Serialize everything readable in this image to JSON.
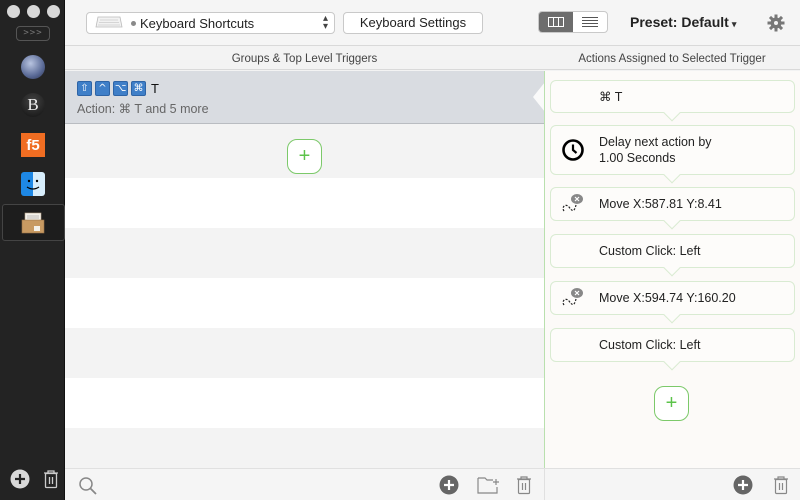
{
  "sidebar": {
    "expand_label": ">>>",
    "apps": [
      {
        "name": "globe-app",
        "icon": "globe-icon"
      },
      {
        "name": "b-app",
        "label": "B",
        "icon": "b-icon"
      },
      {
        "name": "f5-app",
        "label": "f5",
        "icon": "f5-icon"
      },
      {
        "name": "finder-app",
        "icon": "finder-icon"
      },
      {
        "name": "archive-app",
        "icon": "archive-box-icon",
        "selected": true
      }
    ],
    "bottom": {
      "add": "add-circle-icon",
      "delete": "trash-icon"
    }
  },
  "toolbar": {
    "trigger_type": "Keyboard Shortcuts",
    "keyboard_settings_label": "Keyboard Settings",
    "view_modes": [
      "columns",
      "list"
    ],
    "active_view_mode": "columns",
    "preset_label": "Preset: Default",
    "preset_caret": "▾"
  },
  "columns": {
    "left_header": "Groups & Top Level Triggers",
    "right_header": "Actions Assigned to Selected Trigger"
  },
  "triggers": [
    {
      "modifiers": [
        "⇧",
        "^",
        "⌥",
        "⌘"
      ],
      "key": "T",
      "action_summary": "Action: ⌘ T and 5 more",
      "selected": true
    }
  ],
  "add_trigger_symbol": "+",
  "actions": [
    {
      "icon": "none",
      "label": "⌘ T"
    },
    {
      "icon": "clock-icon",
      "label_line1": "Delay next action by",
      "label_line2": "1.00 Seconds"
    },
    {
      "icon": "mouse-move-icon",
      "label": "Move X:587.81 Y:8.41"
    },
    {
      "icon": "none",
      "label": "Custom Click: Left"
    },
    {
      "icon": "mouse-move-icon",
      "label": "Move X:594.74 Y:160.20"
    },
    {
      "icon": "none",
      "label": "Custom Click: Left"
    }
  ],
  "add_action_symbol": "+",
  "colors": {
    "accent_green": "#5cc34a",
    "modifier_blue": "#3f7fc8",
    "selected_row": "#d9dce1",
    "sidebar_bg": "#232323",
    "f5_orange": "#f06d22"
  }
}
